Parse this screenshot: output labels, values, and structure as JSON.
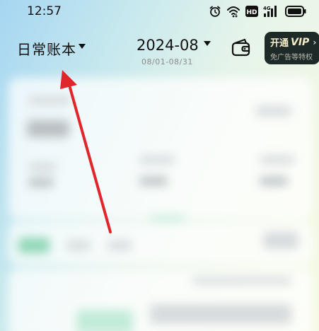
{
  "status_bar": {
    "time": "12:57",
    "hd_badge": "HD",
    "network_label": "4G",
    "icons": [
      "alarm-icon",
      "wifi-icon",
      "hd-icon",
      "signal-icon",
      "battery-icon"
    ]
  },
  "header": {
    "book_name": "日常账本",
    "month": "2024-08",
    "month_range": "08/01-08/31",
    "wallet_icon": "wallet-icon",
    "vip": {
      "title_prefix": "开通",
      "title_vip": "VIP",
      "arrow": "›",
      "subtitle": "免广告等特权"
    }
  },
  "annotation": {
    "arrow_color": "#e0262b",
    "points_to": "book-name-selector"
  },
  "colors": {
    "vip_bg": "#1e2a28",
    "vip_text": "#f4ecc9",
    "accent_green": "#8fd6b6"
  }
}
